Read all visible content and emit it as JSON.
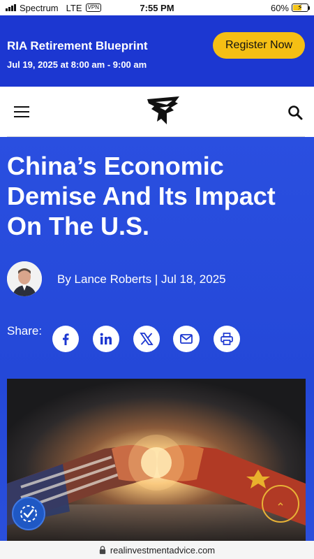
{
  "status_bar": {
    "carrier": "Spectrum",
    "network": "LTE",
    "vpn": "VPN",
    "time": "7:55 PM",
    "battery_percent": "60%",
    "battery_level": 0.6
  },
  "promo": {
    "title": "RIA Retirement Blueprint",
    "date": "Jul 19, 2025 at 8:00 am - 9:00 am",
    "register_label": "Register Now",
    "background_color": "#1c37d1",
    "button_color": "#f5bf14"
  },
  "nav": {
    "menu_icon": "hamburger-menu-icon",
    "logo": "eagle-logo",
    "search_icon": "search-icon"
  },
  "article": {
    "headline": "China’s Economic Demise And Its Impact On The U.S.",
    "byline": "By Lance Roberts | Jul 18, 2025",
    "share_label": "Share:",
    "share_buttons": [
      "facebook-icon",
      "linkedin-icon",
      "x-icon",
      "email-icon",
      "print-icon"
    ],
    "image_description_icon": "clashing-fists-image",
    "hero_color": "#2a4fe0"
  },
  "floating": {
    "accessibility_icon": "accessibility-check-icon",
    "scroll_top_icon": "chevron-up-icon"
  },
  "url_bar": {
    "url": "realinvestmentadvice.com",
    "lock_icon": "lock-icon"
  }
}
